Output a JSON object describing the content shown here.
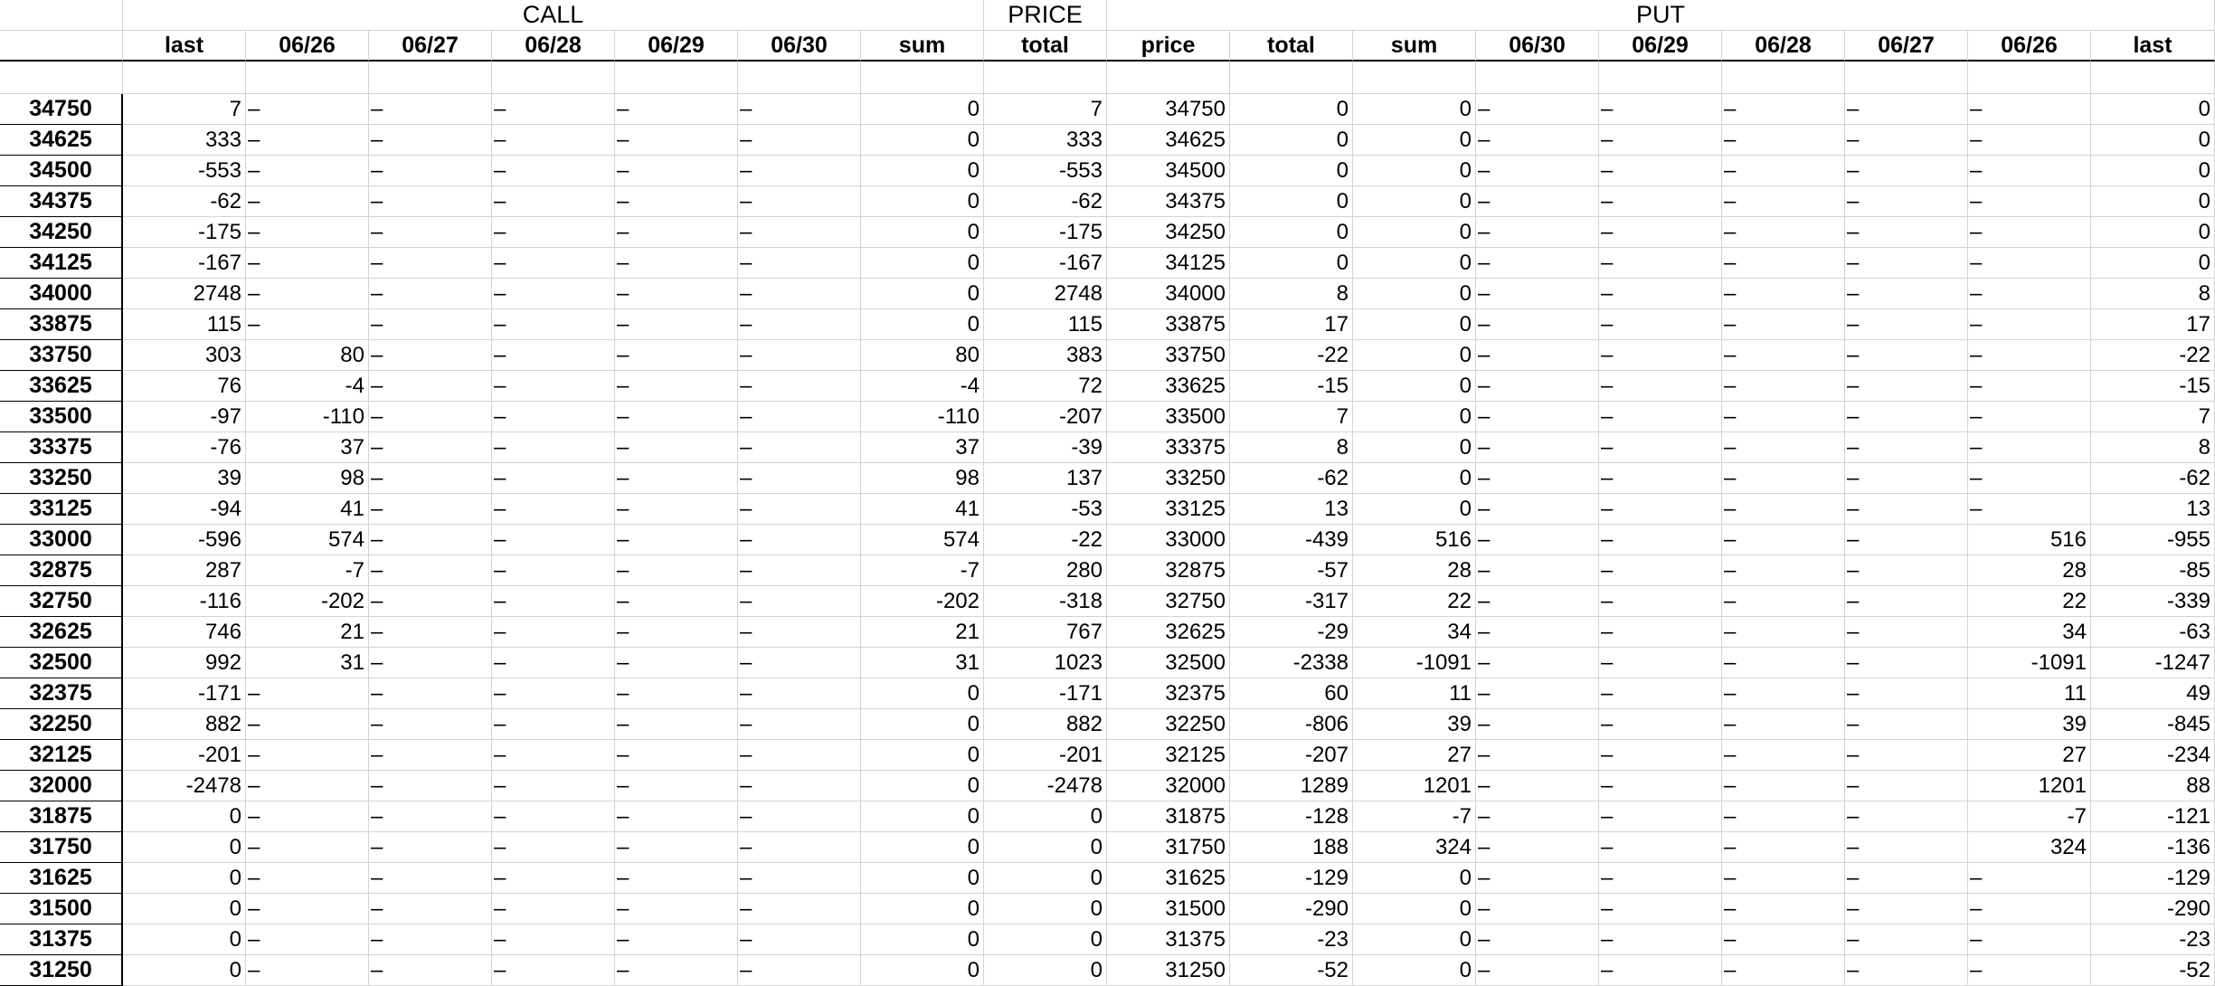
{
  "headers": {
    "groups": [
      "CALL",
      "PRICE",
      "PUT"
    ],
    "columns": [
      "last",
      "06/26",
      "06/27",
      "06/28",
      "06/29",
      "06/30",
      "sum",
      "total",
      "price",
      "total",
      "sum",
      "06/30",
      "06/29",
      "06/28",
      "06/27",
      "06/26",
      "last"
    ]
  },
  "rows": [
    {
      "strike": "34750",
      "cells": [
        "7",
        "–",
        "–",
        "–",
        "–",
        "–",
        "0",
        "7",
        "34750",
        "0",
        "0",
        "–",
        "–",
        "–",
        "–",
        "–",
        "0"
      ]
    },
    {
      "strike": "34625",
      "cells": [
        "333",
        "–",
        "–",
        "–",
        "–",
        "–",
        "0",
        "333",
        "34625",
        "0",
        "0",
        "–",
        "–",
        "–",
        "–",
        "–",
        "0"
      ]
    },
    {
      "strike": "34500",
      "cells": [
        "-553",
        "–",
        "–",
        "–",
        "–",
        "–",
        "0",
        "-553",
        "34500",
        "0",
        "0",
        "–",
        "–",
        "–",
        "–",
        "–",
        "0"
      ]
    },
    {
      "strike": "34375",
      "cells": [
        "-62",
        "–",
        "–",
        "–",
        "–",
        "–",
        "0",
        "-62",
        "34375",
        "0",
        "0",
        "–",
        "–",
        "–",
        "–",
        "–",
        "0"
      ]
    },
    {
      "strike": "34250",
      "cells": [
        "-175",
        "–",
        "–",
        "–",
        "–",
        "–",
        "0",
        "-175",
        "34250",
        "0",
        "0",
        "–",
        "–",
        "–",
        "–",
        "–",
        "0"
      ]
    },
    {
      "strike": "34125",
      "cells": [
        "-167",
        "–",
        "–",
        "–",
        "–",
        "–",
        "0",
        "-167",
        "34125",
        "0",
        "0",
        "–",
        "–",
        "–",
        "–",
        "–",
        "0"
      ]
    },
    {
      "strike": "34000",
      "cells": [
        "2748",
        "–",
        "–",
        "–",
        "–",
        "–",
        "0",
        "2748",
        "34000",
        "8",
        "0",
        "–",
        "–",
        "–",
        "–",
        "–",
        "8"
      ]
    },
    {
      "strike": "33875",
      "cells": [
        "115",
        "–",
        "–",
        "–",
        "–",
        "–",
        "0",
        "115",
        "33875",
        "17",
        "0",
        "–",
        "–",
        "–",
        "–",
        "–",
        "17"
      ]
    },
    {
      "strike": "33750",
      "cells": [
        "303",
        "80",
        "–",
        "–",
        "–",
        "–",
        "80",
        "383",
        "33750",
        "-22",
        "0",
        "–",
        "–",
        "–",
        "–",
        "–",
        "-22"
      ]
    },
    {
      "strike": "33625",
      "cells": [
        "76",
        "-4",
        "–",
        "–",
        "–",
        "–",
        "-4",
        "72",
        "33625",
        "-15",
        "0",
        "–",
        "–",
        "–",
        "–",
        "–",
        "-15"
      ]
    },
    {
      "strike": "33500",
      "cells": [
        "-97",
        "-110",
        "–",
        "–",
        "–",
        "–",
        "-110",
        "-207",
        "33500",
        "7",
        "0",
        "–",
        "–",
        "–",
        "–",
        "–",
        "7"
      ]
    },
    {
      "strike": "33375",
      "cells": [
        "-76",
        "37",
        "–",
        "–",
        "–",
        "–",
        "37",
        "-39",
        "33375",
        "8",
        "0",
        "–",
        "–",
        "–",
        "–",
        "–",
        "8"
      ]
    },
    {
      "strike": "33250",
      "cells": [
        "39",
        "98",
        "–",
        "–",
        "–",
        "–",
        "98",
        "137",
        "33250",
        "-62",
        "0",
        "–",
        "–",
        "–",
        "–",
        "–",
        "-62"
      ]
    },
    {
      "strike": "33125",
      "cells": [
        "-94",
        "41",
        "–",
        "–",
        "–",
        "–",
        "41",
        "-53",
        "33125",
        "13",
        "0",
        "–",
        "–",
        "–",
        "–",
        "–",
        "13"
      ]
    },
    {
      "strike": "33000",
      "cells": [
        "-596",
        "574",
        "–",
        "–",
        "–",
        "–",
        "574",
        "-22",
        "33000",
        "-439",
        "516",
        "–",
        "–",
        "–",
        "–",
        "516",
        "-955"
      ]
    },
    {
      "strike": "32875",
      "cells": [
        "287",
        "-7",
        "–",
        "–",
        "–",
        "–",
        "-7",
        "280",
        "32875",
        "-57",
        "28",
        "–",
        "–",
        "–",
        "–",
        "28",
        "-85"
      ]
    },
    {
      "strike": "32750",
      "cells": [
        "-116",
        "-202",
        "–",
        "–",
        "–",
        "–",
        "-202",
        "-318",
        "32750",
        "-317",
        "22",
        "–",
        "–",
        "–",
        "–",
        "22",
        "-339"
      ]
    },
    {
      "strike": "32625",
      "cells": [
        "746",
        "21",
        "–",
        "–",
        "–",
        "–",
        "21",
        "767",
        "32625",
        "-29",
        "34",
        "–",
        "–",
        "–",
        "–",
        "34",
        "-63"
      ]
    },
    {
      "strike": "32500",
      "cells": [
        "992",
        "31",
        "–",
        "–",
        "–",
        "–",
        "31",
        "1023",
        "32500",
        "-2338",
        "-1091",
        "–",
        "–",
        "–",
        "–",
        "-1091",
        "-1247"
      ]
    },
    {
      "strike": "32375",
      "cells": [
        "-171",
        "–",
        "–",
        "–",
        "–",
        "–",
        "0",
        "-171",
        "32375",
        "60",
        "11",
        "–",
        "–",
        "–",
        "–",
        "11",
        "49"
      ]
    },
    {
      "strike": "32250",
      "cells": [
        "882",
        "–",
        "–",
        "–",
        "–",
        "–",
        "0",
        "882",
        "32250",
        "-806",
        "39",
        "–",
        "–",
        "–",
        "–",
        "39",
        "-845"
      ]
    },
    {
      "strike": "32125",
      "cells": [
        "-201",
        "–",
        "–",
        "–",
        "–",
        "–",
        "0",
        "-201",
        "32125",
        "-207",
        "27",
        "–",
        "–",
        "–",
        "–",
        "27",
        "-234"
      ]
    },
    {
      "strike": "32000",
      "cells": [
        "-2478",
        "–",
        "–",
        "–",
        "–",
        "–",
        "0",
        "-2478",
        "32000",
        "1289",
        "1201",
        "–",
        "–",
        "–",
        "–",
        "1201",
        "88"
      ]
    },
    {
      "strike": "31875",
      "cells": [
        "0",
        "–",
        "–",
        "–",
        "–",
        "–",
        "0",
        "0",
        "31875",
        "-128",
        "-7",
        "–",
        "–",
        "–",
        "–",
        "-7",
        "-121"
      ]
    },
    {
      "strike": "31750",
      "cells": [
        "0",
        "–",
        "–",
        "–",
        "–",
        "–",
        "0",
        "0",
        "31750",
        "188",
        "324",
        "–",
        "–",
        "–",
        "–",
        "324",
        "-136"
      ]
    },
    {
      "strike": "31625",
      "cells": [
        "0",
        "–",
        "–",
        "–",
        "–",
        "–",
        "0",
        "0",
        "31625",
        "-129",
        "0",
        "–",
        "–",
        "–",
        "–",
        "–",
        "-129"
      ]
    },
    {
      "strike": "31500",
      "cells": [
        "0",
        "–",
        "–",
        "–",
        "–",
        "–",
        "0",
        "0",
        "31500",
        "-290",
        "0",
        "–",
        "–",
        "–",
        "–",
        "–",
        "-290"
      ]
    },
    {
      "strike": "31375",
      "cells": [
        "0",
        "–",
        "–",
        "–",
        "–",
        "–",
        "0",
        "0",
        "31375",
        "-23",
        "0",
        "–",
        "–",
        "–",
        "–",
        "–",
        "-23"
      ]
    },
    {
      "strike": "31250",
      "cells": [
        "0",
        "–",
        "–",
        "–",
        "–",
        "–",
        "0",
        "0",
        "31250",
        "-52",
        "0",
        "–",
        "–",
        "–",
        "–",
        "–",
        "-52"
      ]
    }
  ]
}
